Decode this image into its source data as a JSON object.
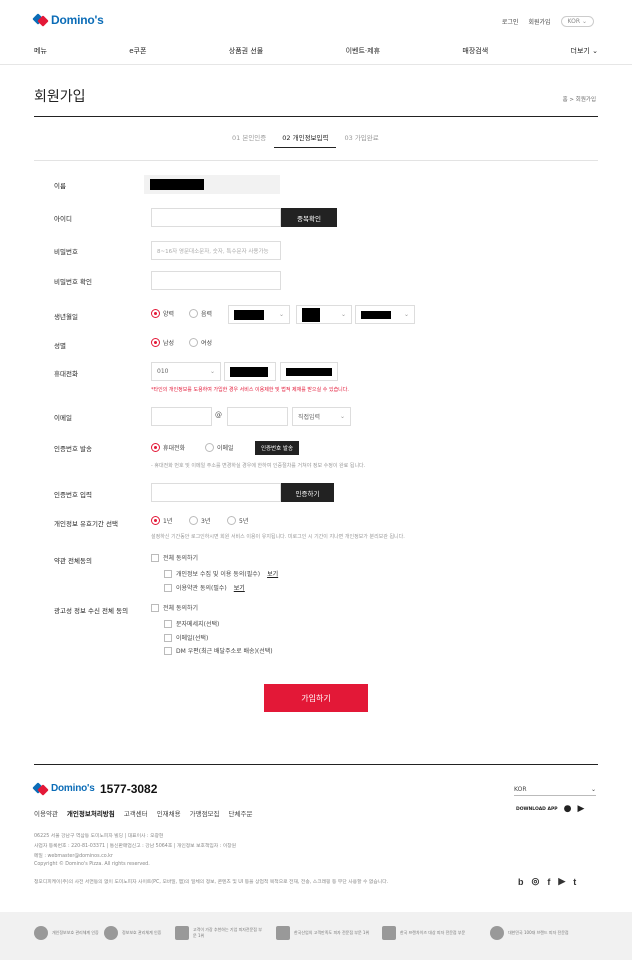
{
  "header": {
    "logo_text": "Domino's",
    "login": "로그인",
    "signup": "회원가입",
    "lang": "KOR",
    "nav": [
      "메뉴",
      "e쿠폰",
      "상품권 선물",
      "이벤트·제휴",
      "매장검색"
    ],
    "more": "더보기"
  },
  "page": {
    "title": "회원가입",
    "breadcrumb": "홈 > 회원가입",
    "steps": [
      "01 본인인증",
      "02 개인정보입력",
      "03 가입완료"
    ]
  },
  "form": {
    "name_label": "이름",
    "id_label": "아이디",
    "id_check_button": "중복확인",
    "pw_label": "비밀번호",
    "pw_placeholder": "8~16자 영문대소문자, 숫자, 특수문자 사용가능",
    "pw_confirm_label": "비밀번호 확인",
    "birth_label": "생년월일",
    "birth_options": [
      "양력",
      "음력"
    ],
    "gender_label": "성별",
    "gender_options": [
      "남성",
      "여성"
    ],
    "phone_label": "휴대전화",
    "phone_prefix": "010",
    "phone_note": "*타인의 개인정보를 도용하여 가입한 경우 서비스 이용제한 및 법적 제재를 받으실 수 있습니다.",
    "email_label": "이메일",
    "email_at": "@",
    "email_direct": "직접입력",
    "auth_label": "인증번호 발송",
    "auth_options": [
      "휴대전화",
      "이메일"
    ],
    "auth_send_button": "인증번호 발송",
    "auth_note": "- 휴대전화 번호 및 이메일 주소를 변경하실 경우에 한하여 인증절차를 거쳐야 정보 수정이 완료 됩니다.",
    "auth_input_label": "인증번호 입력",
    "auth_verify_button": "인증하기",
    "retention_label": "개인정보 유효기간 선택",
    "retention_options": [
      "1년",
      "3년",
      "5년"
    ],
    "retention_note": "설정하신 기간동안 로그인하시면 회원 서비스 이용이 유지됩니다. 미로그인 시 기간이 지나면 개인정보가 분리보관 됩니다.",
    "terms_label": "약관 전체동의",
    "terms_all": "전체 동의하기",
    "terms_items": [
      "개인정보 수집 및 이용 동의(필수)",
      "이용약관 동의(필수)"
    ],
    "terms_view": "보기",
    "ad_label": "광고성 정보 수신 전체 동의",
    "ad_all": "전체 동의하기",
    "ad_items": [
      "문자메세지(선택)",
      "이메일(선택)",
      "DM 우편(최근 배달주소로 배송)(선택)"
    ],
    "submit": "가입하기"
  },
  "footer": {
    "logo_text": "Domino's",
    "phone": "1577-3082",
    "nav": [
      "이용약관",
      "개인정보처리방침",
      "고객센터",
      "인재채용",
      "가맹점모집",
      "단체주문"
    ],
    "info": [
      "06225 서울 강남구 역삼동 도미노피자 빌딩 | 대표이사 : 오광현",
      "사업자 등록번호 : 220-81-03371 | 통신판매업신고 : 강남 5064호 | 개인정보 보호책임자 : 이창원",
      "메일 : webmaster@dominos.co.kr",
      "Copyright © Domino's Pizza. All rights reserved."
    ],
    "notice": "청오디피케이(주)의 사전 서면동의 없이 도미노피자 사이트(PC, 모바일, 앱)의 일체의 정보, 콘텐츠 및 UI 등을 상업적 목적으로 전재, 전송, 스크래핑 등 무단 사용할 수 없습니다.",
    "lang": "KOR",
    "download": "DOWNLOAD APP",
    "socials": [
      "b",
      "◎",
      "f",
      "▶",
      "t"
    ],
    "certs": [
      "개인정보보호 관리체계 인증",
      "정보보호 관리체계 인증",
      "고객이 가장 추천하는 기업 피자전문점 부문 1위",
      "한국산업의 고객만족도 피자 전문점 부문 1위",
      "한국 프랜차이즈 대상 피자 전문점 부문",
      "대한민국 100대 브랜드 피자 전문점"
    ]
  },
  "colors": {
    "brand_red": "#e31837",
    "brand_blue": "#0b6cb7",
    "dark": "#222222"
  }
}
